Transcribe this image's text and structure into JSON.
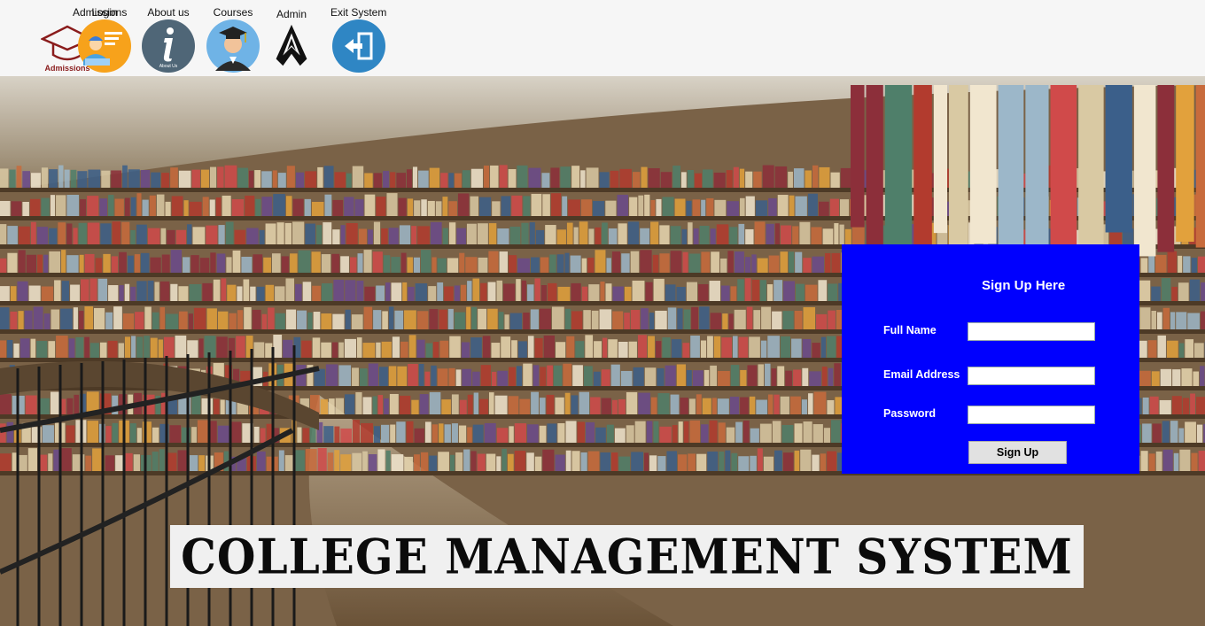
{
  "toolbar": {
    "items": [
      {
        "label": "Admissions",
        "icon": "graduation-cap-icon",
        "caption": "Admissions"
      },
      {
        "label": "Login",
        "icon": "student-login-icon"
      },
      {
        "label": "About us",
        "icon": "info-icon",
        "caption": "About Us"
      },
      {
        "label": "Courses",
        "icon": "graduate-avatar-icon"
      },
      {
        "label": "Admin",
        "icon": "admin-emblem-icon"
      },
      {
        "label": "Exit System",
        "icon": "exit-door-icon"
      }
    ]
  },
  "signup": {
    "title": "Sign Up Here",
    "full_name_label": "Full Name",
    "full_name_value": "",
    "email_label": "Email Address",
    "email_value": "",
    "password_label": "Password",
    "password_value": "",
    "button_label": "Sign Up",
    "panel_color": "#0000fe"
  },
  "banner": {
    "title": "COLLEGE  MANAGEMENT SYSTEM"
  },
  "background": {
    "scene": "library-bookshelves-image"
  }
}
